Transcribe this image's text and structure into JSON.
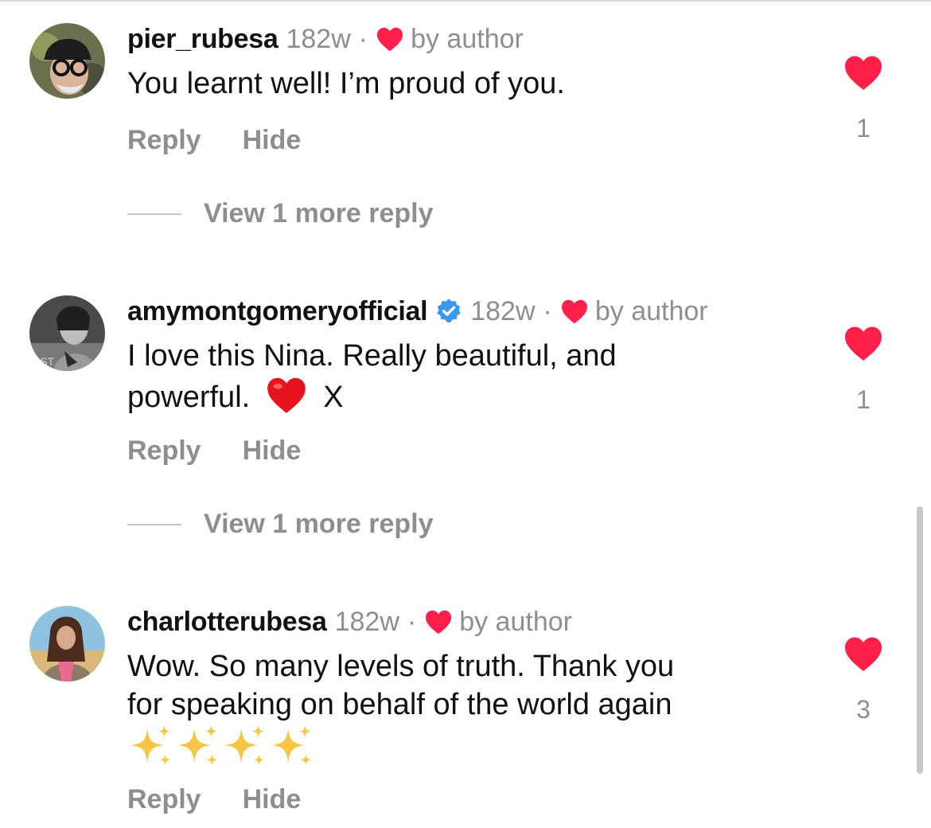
{
  "colors": {
    "heart": "#ff1f4a",
    "meta_text": "#8e8e8e",
    "verified": "#3897f0"
  },
  "comments": [
    {
      "username": "pier_rubesa",
      "time": "182w",
      "separator": "·",
      "liked_by": "by author",
      "verified": false,
      "lines": [
        "You learnt well! I’m proud of you."
      ],
      "reply_label": "Reply",
      "hide_label": "Hide",
      "like_count": "1",
      "view_more": "View 1 more reply"
    },
    {
      "username": "amymontgomeryofficial",
      "time": "182w",
      "separator": "·",
      "liked_by": "by author",
      "verified": true,
      "lines": [
        "I love this Nina. Really beautiful, and",
        "powerful."
      ],
      "line_suffix_emoji": "red-heart-emoji",
      "line_tail": "X",
      "reply_label": "Reply",
      "hide_label": "Hide",
      "like_count": "1",
      "view_more": "View 1 more reply"
    },
    {
      "username": "charlotterubesa",
      "time": "182w",
      "separator": "·",
      "liked_by": "by author",
      "verified": false,
      "lines": [
        "Wow. So many levels of truth. Thank you",
        "for speaking on behalf of the world again"
      ],
      "emoji_line": [
        "sparkles-emoji",
        "sparkles-emoji",
        "sparkles-emoji",
        "sparkles-emoji"
      ],
      "reply_label": "Reply",
      "hide_label": "Hide",
      "like_count": "3"
    }
  ],
  "icons": {
    "like": "heart-icon",
    "author_like": "heart-icon",
    "verified": "verified-badge-icon"
  }
}
